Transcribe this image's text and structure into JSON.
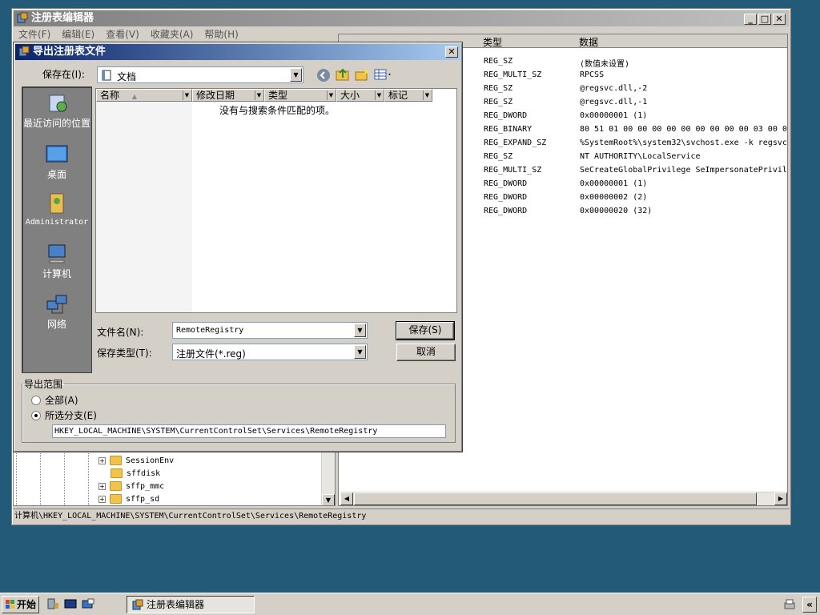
{
  "regedit": {
    "title": "注册表编辑器",
    "menu": [
      "文件(F)",
      "编辑(E)",
      "查看(V)",
      "收藏夹(A)",
      "帮助(H)"
    ],
    "columns": {
      "type": "类型",
      "data": "数据"
    },
    "rows": [
      {
        "type": "REG_SZ",
        "data": "(数值未设置)"
      },
      {
        "type": "REG_MULTI_SZ",
        "data": "RPCSS"
      },
      {
        "type": "REG_SZ",
        "data": "@regsvc.dll,-2"
      },
      {
        "type": "REG_SZ",
        "data": "@regsvc.dll,-1"
      },
      {
        "type": "REG_DWORD",
        "data": "0x00000001 (1)"
      },
      {
        "type": "REG_BINARY",
        "data": "80 51 01 00 00 00 00 00 00 00 00 00 03 00 0"
      },
      {
        "type": "REG_EXPAND_SZ",
        "data": "%SystemRoot%\\system32\\svchost.exe -k regsvc"
      },
      {
        "type": "REG_SZ",
        "data": "NT AUTHORITY\\LocalService"
      },
      {
        "type": "REG_MULTI_SZ",
        "data": "SeCreateGlobalPrivilege SeImpersonatePrivil"
      },
      {
        "type": "REG_DWORD",
        "data": "0x00000001 (1)"
      },
      {
        "type": "REG_DWORD",
        "data": "0x00000002 (2)"
      },
      {
        "type": "REG_DWORD",
        "data": "0x00000020 (32)"
      }
    ],
    "tree": [
      "SessionEnv",
      "sffdisk",
      "sffp_mmc",
      "sffp_sd"
    ],
    "status": "计算机\\HKEY_LOCAL_MACHINE\\SYSTEM\\CurrentControlSet\\Services\\RemoteRegistry"
  },
  "dialog": {
    "title": "导出注册表文件",
    "save_in_label": "保存在(I):",
    "save_in_value": "文档",
    "places": [
      "最近访问的位置",
      "桌面",
      "Administrator",
      "计算机",
      "网络"
    ],
    "list_headers": [
      "名称",
      "修改日期",
      "类型",
      "大小",
      "标记"
    ],
    "empty_message": "没有与搜索条件匹配的项。",
    "filename_label": "文件名(N):",
    "filename_value": "RemoteRegistry",
    "filetype_label": "保存类型(T):",
    "filetype_value": "注册文件(*.reg)",
    "save_button": "保存(S)",
    "cancel_button": "取消",
    "export_range": {
      "legend": "导出范围",
      "all": "全部(A)",
      "selected": "所选分支(E)",
      "selected_checked": true,
      "branch_path": "HKEY_LOCAL_MACHINE\\SYSTEM\\CurrentControlSet\\Services\\RemoteRegistry"
    }
  },
  "taskbar": {
    "start": "开始",
    "task_item": "注册表编辑器"
  },
  "colors": {
    "desktop": "#235a78",
    "active_title": "#0a246a",
    "inactive_title": "#808080",
    "face": "#d4d0c8"
  }
}
